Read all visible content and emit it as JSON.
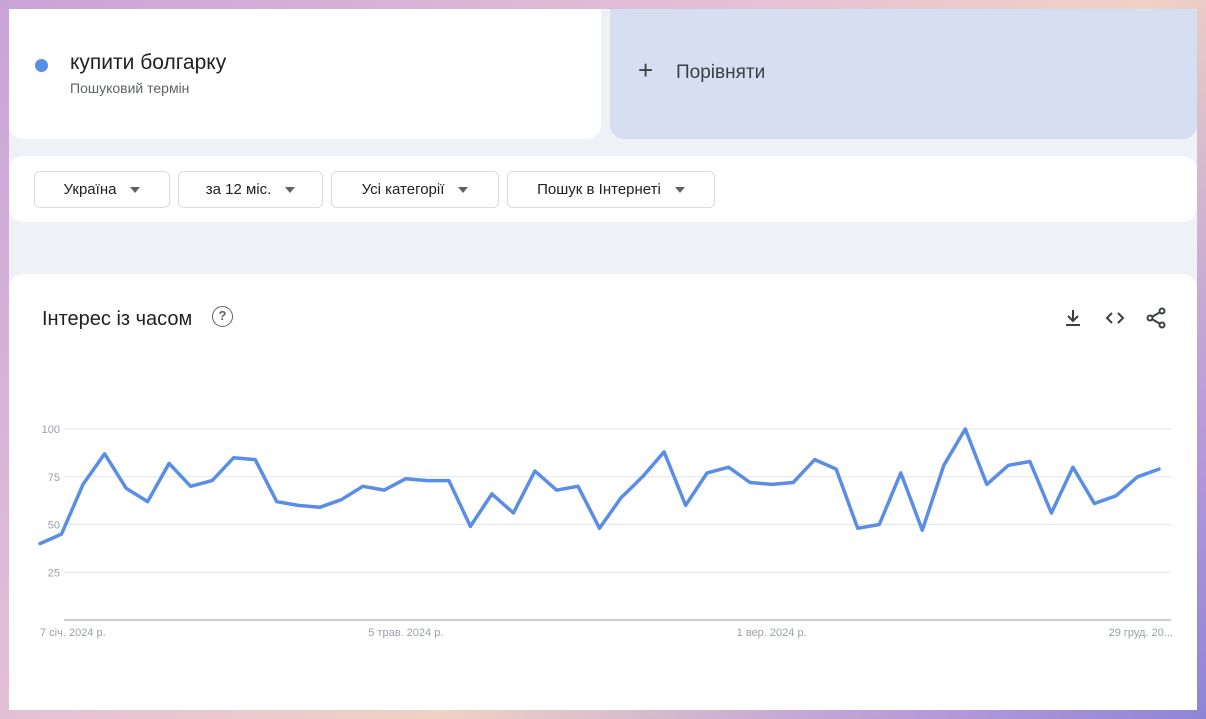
{
  "term": {
    "title": "купити болгарку",
    "subtitle": "Пошуковий термін",
    "color": "#5a8ee6"
  },
  "compare": {
    "plus": "+",
    "label": "Порівняти"
  },
  "filters": [
    {
      "label": "Україна"
    },
    {
      "label": "за 12 міс."
    },
    {
      "label": "Усі категорії"
    },
    {
      "label": "Пошук в Інтернеті"
    }
  ],
  "chart_header": {
    "title": "Інтерес із часом",
    "help_icon": "help-circle-icon",
    "actions": [
      "download-icon",
      "embed-code-icon",
      "share-icon"
    ]
  },
  "chart_data": {
    "type": "line",
    "title": "Інтерес із часом",
    "xlabel": "",
    "ylabel": "",
    "ylim": [
      0,
      100
    ],
    "y_ticks": [
      100,
      75,
      50,
      25
    ],
    "x_tick_labels": [
      "7 січ. 2024 р.",
      "5 трав. 2024 р.",
      "1 вер. 2024 р.",
      "29 груд. 20..."
    ],
    "x_tick_indices": [
      0,
      17,
      34,
      52
    ],
    "grid": true,
    "color": "#5a8ee6",
    "series": [
      {
        "values": [
          40,
          45,
          71,
          87,
          69,
          62,
          82,
          70,
          73,
          85,
          84,
          62,
          60,
          59,
          63,
          70,
          68,
          74,
          73,
          73,
          49,
          66,
          56,
          78,
          68,
          70,
          48,
          64,
          75,
          88,
          60,
          77,
          80,
          72,
          71,
          72,
          84,
          79,
          48,
          50,
          77,
          47,
          81,
          100,
          71,
          81,
          83,
          56,
          80,
          61,
          65,
          75,
          79
        ]
      }
    ]
  }
}
